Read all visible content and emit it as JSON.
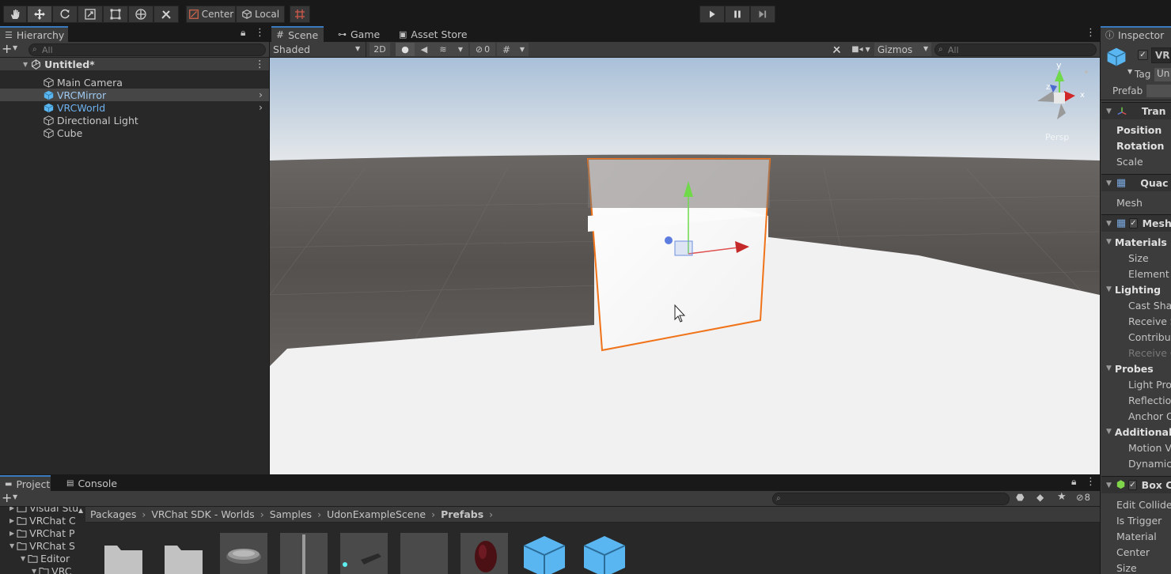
{
  "toolbar": {
    "pivot_label": "Center",
    "space_label": "Local",
    "tools": [
      "hand-tool",
      "move-tool",
      "rotate-tool",
      "scale-tool",
      "rect-tool",
      "transform-tool",
      "custom-tool"
    ]
  },
  "hierarchy": {
    "tab": "Hierarchy",
    "search_placeholder": "All",
    "scene_name": "Untitled*",
    "items": [
      {
        "label": "Main Camera",
        "prefab": false
      },
      {
        "label": "VRCMirror",
        "prefab": true
      },
      {
        "label": "VRCWorld",
        "prefab": true
      },
      {
        "label": "Directional Light",
        "prefab": false
      },
      {
        "label": "Cube",
        "prefab": false
      }
    ]
  },
  "scene_view": {
    "tabs": [
      "Scene",
      "Game",
      "Asset Store"
    ],
    "shading_mode": "Shaded",
    "mode_2d": "2D",
    "hidden_count": "0",
    "gizmos_label": "Gizmos",
    "search_placeholder": "All",
    "persp_label": "Persp",
    "axis_labels": {
      "y": "y",
      "x": "x",
      "z": "z"
    }
  },
  "inspector": {
    "tab": "Inspector",
    "object_name": "VR",
    "tag_label": "Tag",
    "tag_value": "Un",
    "prefab_label": "Prefab",
    "sections": [
      {
        "title": "Tran"
      },
      {
        "title": "Quac"
      },
      {
        "title": "Mesh"
      },
      {
        "title": "Box C"
      }
    ],
    "transform_rows": [
      "Position",
      "Rotation",
      "Scale"
    ],
    "mesh_label": "Mesh",
    "renderer_rows": [
      {
        "label": "Materials",
        "bold": true
      },
      {
        "label": "Size",
        "bold": false
      },
      {
        "label": "Element 0",
        "bold": false
      },
      {
        "label": "Lighting",
        "bold": true
      },
      {
        "label": "Cast Shac",
        "bold": false
      },
      {
        "label": "Receive S",
        "bold": false
      },
      {
        "label": "Contribute",
        "bold": false
      },
      {
        "label": "Receive G",
        "bold": false
      },
      {
        "label": "Probes",
        "bold": true
      },
      {
        "label": "Light Prob",
        "bold": false
      },
      {
        "label": "Reflection",
        "bold": false
      },
      {
        "label": "Anchor Ov",
        "bold": false
      },
      {
        "label": "Additional S",
        "bold": true
      },
      {
        "label": "Motion Ve",
        "bold": false
      },
      {
        "label": "Dynamic",
        "bold": false
      }
    ],
    "collider_rows": [
      "Edit Collider",
      "Is Trigger",
      "Material",
      "Center",
      "Size"
    ]
  },
  "project": {
    "tabs": [
      "Project",
      "Console"
    ],
    "hidden_count": "8",
    "tree": [
      {
        "label": "Visual Stu"
      },
      {
        "label": "VRChat C"
      },
      {
        "label": "VRChat P"
      },
      {
        "label": "VRChat S"
      },
      {
        "label": "Editor"
      },
      {
        "label": "VRC"
      }
    ],
    "breadcrumb": [
      "Packages",
      "VRChat SDK - Worlds",
      "Samples",
      "UdonExampleScene",
      "Prefabs"
    ],
    "assets": [
      "folder",
      "folder",
      "disc-prefab",
      "pole-prefab",
      "box-prefab",
      "empty-prefab",
      "sphere-prefab",
      "cube-prefab",
      "cube-prefab"
    ]
  },
  "colors": {
    "accent": "#3a79bb",
    "selection_outline": "#f0731a",
    "prefab_blue": "#59b6f0",
    "sky_top": "#b2c6dd",
    "ground": "#5a5654"
  }
}
